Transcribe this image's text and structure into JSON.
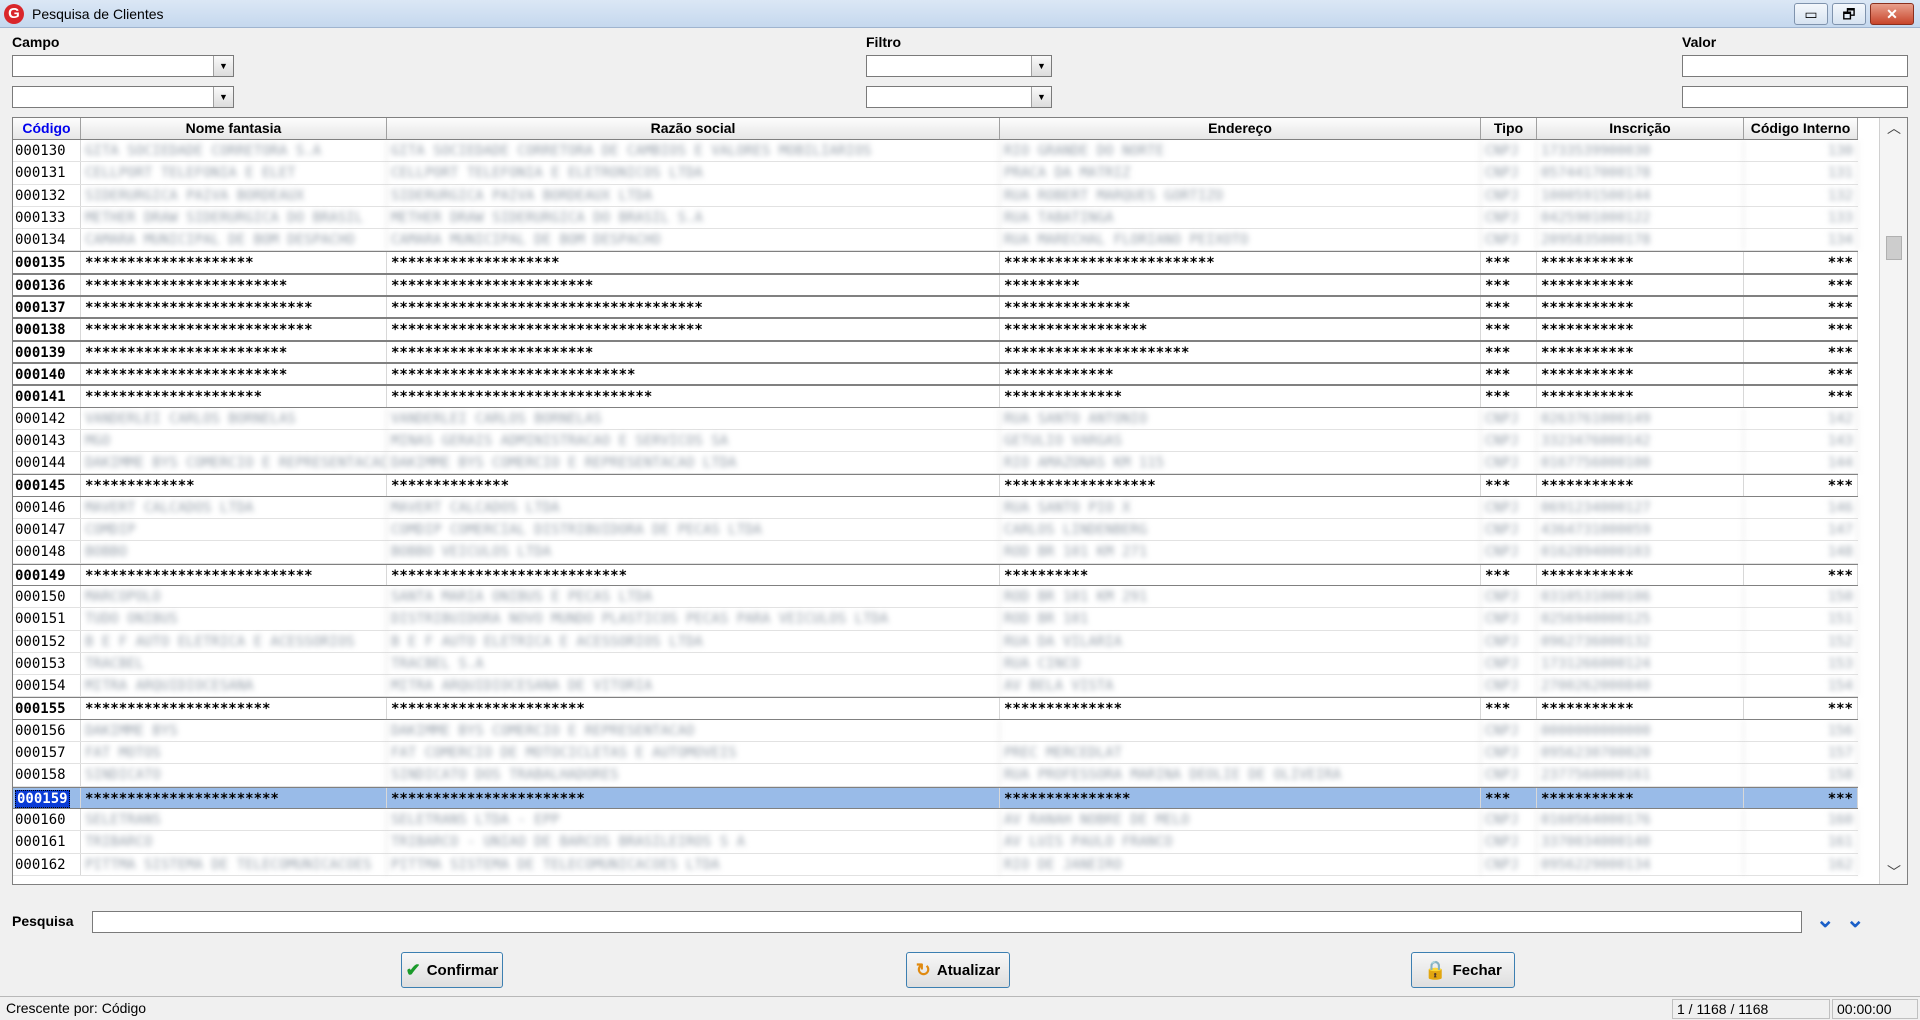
{
  "window": {
    "title": "Pesquisa de Clientes",
    "minimize": "▭",
    "restore": "🗗",
    "close": "✕"
  },
  "filters": {
    "campo_label": "Campo",
    "filtro_label": "Filtro",
    "valor_label": "Valor"
  },
  "columns": [
    "Código",
    "Nome fantasia",
    "Razão social",
    "Endereço",
    "Tipo",
    "Inscrição",
    "Código Interno"
  ],
  "rows": [
    {
      "codigo": "000130",
      "nome": "GITA SOCIEDADE CORRETORA S.A",
      "razao": "GITA SOCIEDADE CORRETORA DE CAMBIOS E VALORES MOBILIARIOS",
      "endereco": "RIO GRANDE DO NORTE",
      "tipo": "CNPJ",
      "inscricao": "1733539900030",
      "interno": "130",
      "style": "blur"
    },
    {
      "codigo": "000131",
      "nome": "CELLPORT TELEFONIA E ELET",
      "razao": "CELLPORT TELEFONIA E ELETRONICOS LTDA",
      "endereco": "PRACA DA MATRIZ",
      "tipo": "CNPJ",
      "inscricao": "0574417000178",
      "interno": "131",
      "style": "blur"
    },
    {
      "codigo": "000132",
      "nome": "SIDERURGICA PAIVA BORDEAUX",
      "razao": "SIDERURGICA PAIVA BORDEAUX LTDA",
      "endereco": "RUA ROBERT MARQUES GORTIZO",
      "tipo": "CNPJ",
      "inscricao": "1000591500144",
      "interno": "132",
      "style": "blur"
    },
    {
      "codigo": "000133",
      "nome": "METHER DRAW SIDERURGICA DO BRASIL",
      "razao": "METHER DRAW SIDERURGICA DO BRASIL S.A",
      "endereco": "RUA TABATINGA",
      "tipo": "CNPJ",
      "inscricao": "0425901000122",
      "interno": "133",
      "style": "blur"
    },
    {
      "codigo": "000134",
      "nome": "CAMARA MUNICIPAL DE BOM DESPACHO",
      "razao": "CAMARA MUNICIPAL DE BOM DESPACHO",
      "endereco": "RUA MARECHAL FLORIANO PEIXOTO",
      "tipo": "CNPJ",
      "inscricao": "2095835000178",
      "interno": "134",
      "style": "blur"
    },
    {
      "codigo": "000135",
      "nome": "********************",
      "razao": "********************",
      "endereco": "*************************",
      "tipo": "***",
      "inscricao": "***********",
      "interno": "***",
      "style": "masked"
    },
    {
      "codigo": "000136",
      "nome": "************************",
      "razao": "************************",
      "endereco": "*********",
      "tipo": "***",
      "inscricao": "***********",
      "interno": "***",
      "style": "masked"
    },
    {
      "codigo": "000137",
      "nome": "***************************",
      "razao": "*************************************",
      "endereco": "***************",
      "tipo": "***",
      "inscricao": "***********",
      "interno": "***",
      "style": "masked"
    },
    {
      "codigo": "000138",
      "nome": "***************************",
      "razao": "*************************************",
      "endereco": "*****************",
      "tipo": "***",
      "inscricao": "***********",
      "interno": "***",
      "style": "masked"
    },
    {
      "codigo": "000139",
      "nome": "************************",
      "razao": "************************",
      "endereco": "**********************",
      "tipo": "***",
      "inscricao": "***********",
      "interno": "***",
      "style": "masked"
    },
    {
      "codigo": "000140",
      "nome": "************************",
      "razao": "*****************************",
      "endereco": "*************",
      "tipo": "***",
      "inscricao": "***********",
      "interno": "***",
      "style": "masked"
    },
    {
      "codigo": "000141",
      "nome": "*********************",
      "razao": "*******************************",
      "endereco": "**************",
      "tipo": "***",
      "inscricao": "***********",
      "interno": "***",
      "style": "masked"
    },
    {
      "codigo": "000142",
      "nome": "VANDERLEI CARLOS BORNELAS",
      "razao": "VANDERLEI CARLOS BORNELAS",
      "endereco": "RUA SANTO ANTONIO",
      "tipo": "CNPJ",
      "inscricao": "0263761000149",
      "interno": "142",
      "style": "blur"
    },
    {
      "codigo": "000143",
      "nome": "MGO",
      "razao": "MINAS GERAIS ADMINISTRACAO E SERVICOS SA",
      "endereco": "GETULIO VARGAS",
      "tipo": "CNPJ",
      "inscricao": "3323476000142",
      "interno": "143",
      "style": "blur"
    },
    {
      "codigo": "000144",
      "nome": "DAKIMME BYS COMERCIO E REPRESENTACAO",
      "razao": "DAKIMME BYS COMERCIO E REPRESENTACAO LTDA",
      "endereco": "RIO AMAZONAS KM 115",
      "tipo": "CNPJ",
      "inscricao": "0167756000100",
      "interno": "144",
      "style": "blur"
    },
    {
      "codigo": "000145",
      "nome": "*************",
      "razao": "**************",
      "endereco": "******************",
      "tipo": "***",
      "inscricao": "***********",
      "interno": "***",
      "style": "masked"
    },
    {
      "codigo": "000146",
      "nome": "MAVERT CALCADOS LTDA",
      "razao": "MAVERT CALCADOS LTDA",
      "endereco": "RUA SANTO PIO X",
      "tipo": "CNPJ",
      "inscricao": "0691234000127",
      "interno": "146",
      "style": "blur"
    },
    {
      "codigo": "000147",
      "nome": "COMDIP",
      "razao": "COMDIP COMERCIAL DISTRIBUIDORA DE PECAS LTDA",
      "endereco": "CARLOS LINDENBERG",
      "tipo": "CNPJ",
      "inscricao": "4364731000059",
      "interno": "147",
      "style": "blur"
    },
    {
      "codigo": "000148",
      "nome": "BOBBO",
      "razao": "BOBBO VEICULOS LTDA",
      "endereco": "ROD BR 101 KM 271",
      "tipo": "CNPJ",
      "inscricao": "0162894000103",
      "interno": "148",
      "style": "blur"
    },
    {
      "codigo": "000149",
      "nome": "***************************",
      "razao": "****************************",
      "endereco": "**********",
      "tipo": "***",
      "inscricao": "***********",
      "interno": "***",
      "style": "masked"
    },
    {
      "codigo": "000150",
      "nome": "MARCOPOLO",
      "razao": "SANTA MARIA ONIBUS E PECAS LTDA",
      "endereco": "ROD BR 101 KM 291",
      "tipo": "CNPJ",
      "inscricao": "0310531000106",
      "interno": "150",
      "style": "blur"
    },
    {
      "codigo": "000151",
      "nome": "TUDO ONIBUS",
      "razao": "DISTRIBUIDORA NOVO MUNDO PLASTICOS PECAS PARA VEICULOS LTDA",
      "endereco": "ROD BR 101",
      "tipo": "CNPJ",
      "inscricao": "0256940000125",
      "interno": "151",
      "style": "blur"
    },
    {
      "codigo": "000152",
      "nome": "B E F AUTO ELETRICA E ACESSORIOS",
      "razao": "B E F AUTO ELETRICA E ACESSORIOS LTDA",
      "endereco": "RUA DA VILARIA",
      "tipo": "CNPJ",
      "inscricao": "0962736000132",
      "interno": "152",
      "style": "blur"
    },
    {
      "codigo": "000153",
      "nome": "TRACBEL",
      "razao": "TRACBEL S.A",
      "endereco": "RUA CINCO",
      "tipo": "CNPJ",
      "inscricao": "1731266000124",
      "interno": "153",
      "style": "blur"
    },
    {
      "codigo": "000154",
      "nome": "MITRA ARQUIDIOCESANA",
      "razao": "MITRA ARQUIDIOCESANA DE VITORIA",
      "endereco": "AV BELA VISTA",
      "tipo": "CNPJ",
      "inscricao": "2700262000840",
      "interno": "154",
      "style": "blur"
    },
    {
      "codigo": "000155",
      "nome": "**********************",
      "razao": "***********************",
      "endereco": "**************",
      "tipo": "***",
      "inscricao": "***********",
      "interno": "***",
      "style": "masked"
    },
    {
      "codigo": "000156",
      "nome": "DAKIMME BYS",
      "razao": "DAKIMME BYS COMERCIO E REPRESENTACAO",
      "endereco": "",
      "tipo": "CNPJ",
      "inscricao": "0000000000000",
      "interno": "156",
      "style": "blur"
    },
    {
      "codigo": "000157",
      "nome": "FAT MOTOS",
      "razao": "FAT COMERCIO DE MOTOCICLETAS E AUTOMOVEIS",
      "endereco": "PREC MERCEDLAT",
      "tipo": "CNPJ",
      "inscricao": "0956230700020",
      "interno": "157",
      "style": "blur"
    },
    {
      "codigo": "000158",
      "nome": "SINDICATO",
      "razao": "SINDICATO DOS TRABALHADORES",
      "endereco": "RUA PROFESSORA MARINA DEOLIE DE OLIVEIRA",
      "tipo": "CNPJ",
      "inscricao": "2377560000161",
      "interno": "158",
      "style": "blur"
    },
    {
      "codigo": "000159",
      "nome": "***********************",
      "razao": "***********************",
      "endereco": "***************",
      "tipo": "***",
      "inscricao": "***********",
      "interno": "***",
      "style": "masked selected"
    },
    {
      "codigo": "000160",
      "nome": "SELETRANS",
      "razao": "SELETRANS LTDA - EPP",
      "endereco": "AV RANAH NOBRE DE MELO",
      "tipo": "CNPJ",
      "inscricao": "0160564000176",
      "interno": "160",
      "style": "blur"
    },
    {
      "codigo": "000161",
      "nome": "TRIBARCO",
      "razao": "TRIBARCO - UNIAO DE BARCOS BRASILEIROS S A",
      "endereco": "AV LUIS PAULO FRANCO",
      "tipo": "CNPJ",
      "inscricao": "3370034000140",
      "interno": "161",
      "style": "blur"
    },
    {
      "codigo": "000162",
      "nome": "PITTMA SISTEMA DE TELECOMUNICACOES",
      "razao": "PITTMA SISTEMA DE TELECOMUNICACOES LTDA",
      "endereco": "RIO DE JANEIRO",
      "tipo": "CNPJ",
      "inscricao": "0956229000134",
      "interno": "162",
      "style": "blur"
    }
  ],
  "search": {
    "label": "Pesquisa",
    "value": ""
  },
  "buttons": {
    "confirm": "Confirmar",
    "refresh": "Atualizar",
    "close": "Fechar"
  },
  "status": {
    "sort": "Crescente por: Código",
    "count": "1 / 1168 / 1168",
    "time": "00:00:00"
  },
  "icons": [
    "app-logo-icon",
    "check-icon",
    "refresh-icon",
    "lock-icon",
    "chevron-double-down-icon",
    "chevron-bar-down-icon"
  ],
  "colors": {
    "selected_row": "#99bbe8",
    "sorted_header": "#0000ee",
    "accent": "#1a5fc8"
  }
}
